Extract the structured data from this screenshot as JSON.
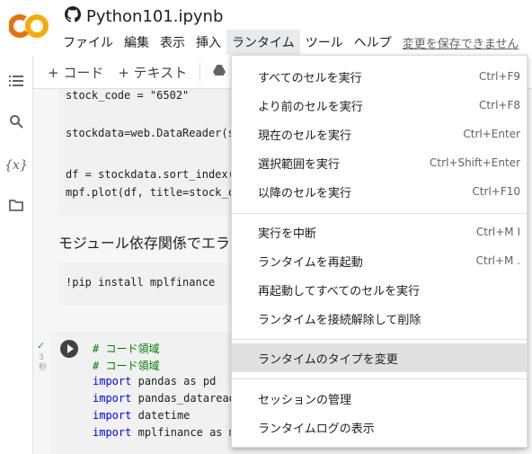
{
  "header": {
    "title": "Python101.ipynb",
    "logo_text": "CO",
    "menu": [
      "ファイル",
      "編集",
      "表示",
      "挿入",
      "ランタイム",
      "ツール",
      "ヘルプ"
    ],
    "save_status": "変更を保存できません"
  },
  "toolbar": {
    "add_code": "+ コード",
    "add_text": "+ テキスト"
  },
  "sidebar": {
    "icons": [
      "table-of-contents-icon",
      "search-icon",
      "variables-icon",
      "folder-icon"
    ],
    "variables_label": "{x}"
  },
  "notebook": {
    "cell1_lines": [
      "stock_code = \"6502\"",
      "",
      "stockdata=web.DataReader(st",
      "",
      "df = stockdata.sort_index()",
      "mpf.plot(df, title=stock_co"
    ],
    "markdown": "モジュール依存関係でエラ",
    "pip_line": "!pip install mplfinance",
    "cell3_comment1": "# コード領域",
    "cell3_comment2": "# コード領域",
    "cell3_import_kw": "import",
    "cell3_imports": [
      "pandas as pd",
      "pandas_dataread",
      "datetime",
      "mplfinance as m"
    ],
    "exec_check": "✓",
    "exec_time": "3\n秒"
  },
  "dropdown": {
    "items": [
      {
        "label": "すべてのセルを実行",
        "shortcut": "Ctrl+F9"
      },
      {
        "label": "より前のセルを実行",
        "shortcut": "Ctrl+F8"
      },
      {
        "label": "現在のセルを実行",
        "shortcut": "Ctrl+Enter"
      },
      {
        "label": "選択範囲を実行",
        "shortcut": "Ctrl+Shift+Enter"
      },
      {
        "label": "以降のセルを実行",
        "shortcut": "Ctrl+F10"
      },
      {
        "label": "実行を中断",
        "shortcut": "Ctrl+M I"
      },
      {
        "label": "ランタイムを再起動",
        "shortcut": "Ctrl+M ."
      },
      {
        "label": "再起動してすべてのセルを実行",
        "shortcut": ""
      },
      {
        "label": "ランタイムを接続解除して削除",
        "shortcut": ""
      },
      {
        "label": "ランタイムのタイプを変更",
        "shortcut": ""
      },
      {
        "label": "セッションの管理",
        "shortcut": ""
      },
      {
        "label": "ランタイムログの表示",
        "shortcut": ""
      }
    ]
  },
  "colors": {
    "logo_orange": "#f9ab00",
    "logo_dark_orange": "#e8710a",
    "highlight": "#e0e0e0",
    "keyword": "#0000ff",
    "comment": "#008000"
  }
}
